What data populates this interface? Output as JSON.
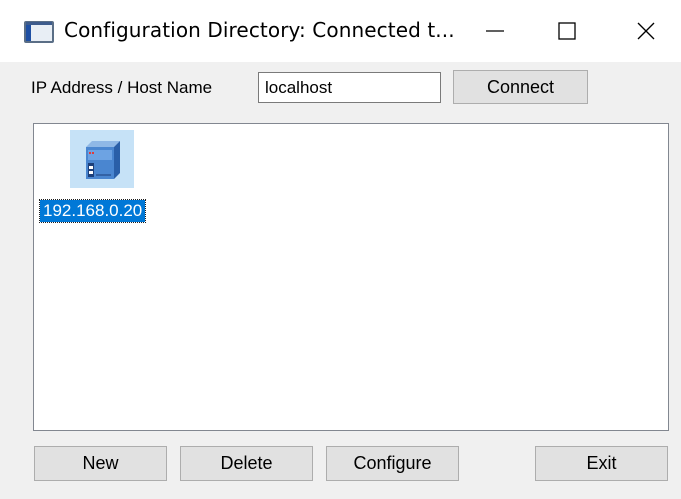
{
  "window": {
    "title": "Configuration Directory: Connected t...",
    "icon": "app-window-icon",
    "controls": {
      "minimize": "—",
      "maximize": "☐",
      "close": "✕"
    }
  },
  "connection": {
    "label": "IP Address / Host Name",
    "host_value": "localhost",
    "connect_label": "Connect"
  },
  "devices": {
    "items": [
      {
        "label": "192.168.0.20",
        "icon": "server-device-icon",
        "selected": true
      }
    ]
  },
  "actions": {
    "new_label": "New",
    "delete_label": "Delete",
    "configure_label": "Configure",
    "exit_label": "Exit"
  },
  "colors": {
    "selection": "#0078d7",
    "icon_highlight": "#c6e2f7",
    "button_face": "#e1e1e1",
    "background": "#f0f0f0"
  }
}
